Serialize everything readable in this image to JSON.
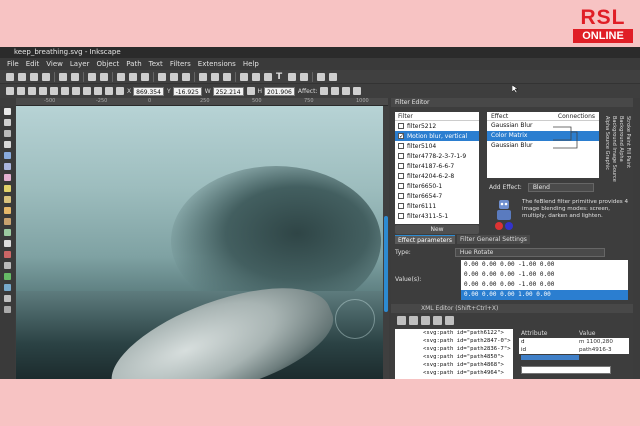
{
  "logo": {
    "top": "RSL",
    "bottom": "ONLINE"
  },
  "window": {
    "title": "keep_breathing.svg - Inkscape",
    "menu": [
      "File",
      "Edit",
      "View",
      "Layer",
      "Object",
      "Path",
      "Text",
      "Filters",
      "Extensions",
      "Help"
    ]
  },
  "coords": {
    "x_label": "X",
    "x": "869.354",
    "y_label": "Y",
    "y": "-16.925",
    "w_label": "W",
    "w": "252.214",
    "h_label": "H",
    "h": "201.906",
    "affect": "Affect:"
  },
  "ruler": [
    "-500",
    "-250",
    "0",
    "250",
    "500",
    "750",
    "1000"
  ],
  "filter_editor": {
    "title": "Filter Editor",
    "filter_header": "Filter",
    "filters": [
      {
        "name": "filter5212",
        "checked": false,
        "selected": false
      },
      {
        "name": "Motion blur, vertical",
        "checked": true,
        "selected": true
      },
      {
        "name": "filter5104",
        "checked": false,
        "selected": false
      },
      {
        "name": "filter4778-2-3-7-1-9",
        "checked": false,
        "selected": false
      },
      {
        "name": "filter4187-6-6-7",
        "checked": false,
        "selected": false
      },
      {
        "name": "filter4204-6-2-8",
        "checked": false,
        "selected": false
      },
      {
        "name": "filter6650-1",
        "checked": false,
        "selected": false
      },
      {
        "name": "filter6654-7",
        "checked": false,
        "selected": false
      },
      {
        "name": "filter6111",
        "checked": false,
        "selected": false
      },
      {
        "name": "filter4311-5-1",
        "checked": false,
        "selected": false
      }
    ],
    "new_button": "New",
    "effect_header": "Effect",
    "connections_header": "Connections",
    "effects": [
      {
        "name": "Gaussian Blur",
        "selected": false
      },
      {
        "name": "Color Matrix",
        "selected": true
      },
      {
        "name": "Gaussian Blur",
        "selected": false
      }
    ],
    "vertical_labels": "Stroke Paint Fill Paint Background Alpha Background Image Source Alpha Source Graphic",
    "add_effect_label": "Add Effect:",
    "add_effect_value": "Blend",
    "description": "The feBlend filter primitive provides 4 image blending modes: screen, multiply, darken and lighten.",
    "tabs": [
      "Effect parameters",
      "Filter General Settings"
    ],
    "type_label": "Type:",
    "type_value": "Hue Rotate",
    "values_label": "Value(s):",
    "matrix": [
      "0.00  0.00  0.00  -1.00  0.00",
      "0.00  0.00  0.00  -1.00  0.00",
      "0.00  0.00  0.00  -1.00  0.00",
      "0.00  0.00  0.00   1.00  0.00"
    ],
    "matrix_selected_row": 3
  },
  "xml_editor": {
    "title": "XML Editor (Shift+Ctrl+X)",
    "nodes": [
      "<svg:path id=\"path6122\">",
      "<svg:path id=\"path2847-0\">",
      "<svg:path id=\"path2836-7\">",
      "<svg:path id=\"path4850\">",
      "<svg:path id=\"path4868\">",
      "<svg:path id=\"path4964\">"
    ],
    "attr_header": "Attribute",
    "value_header": "Value",
    "attributes": [
      {
        "name": "d",
        "value": "m 1100,280"
      },
      {
        "name": "id",
        "value": "path4916-3"
      }
    ]
  },
  "colors": {
    "accent": "#2b7ed0",
    "logo_red": "#e01e26",
    "background": "#f7c3c3"
  }
}
